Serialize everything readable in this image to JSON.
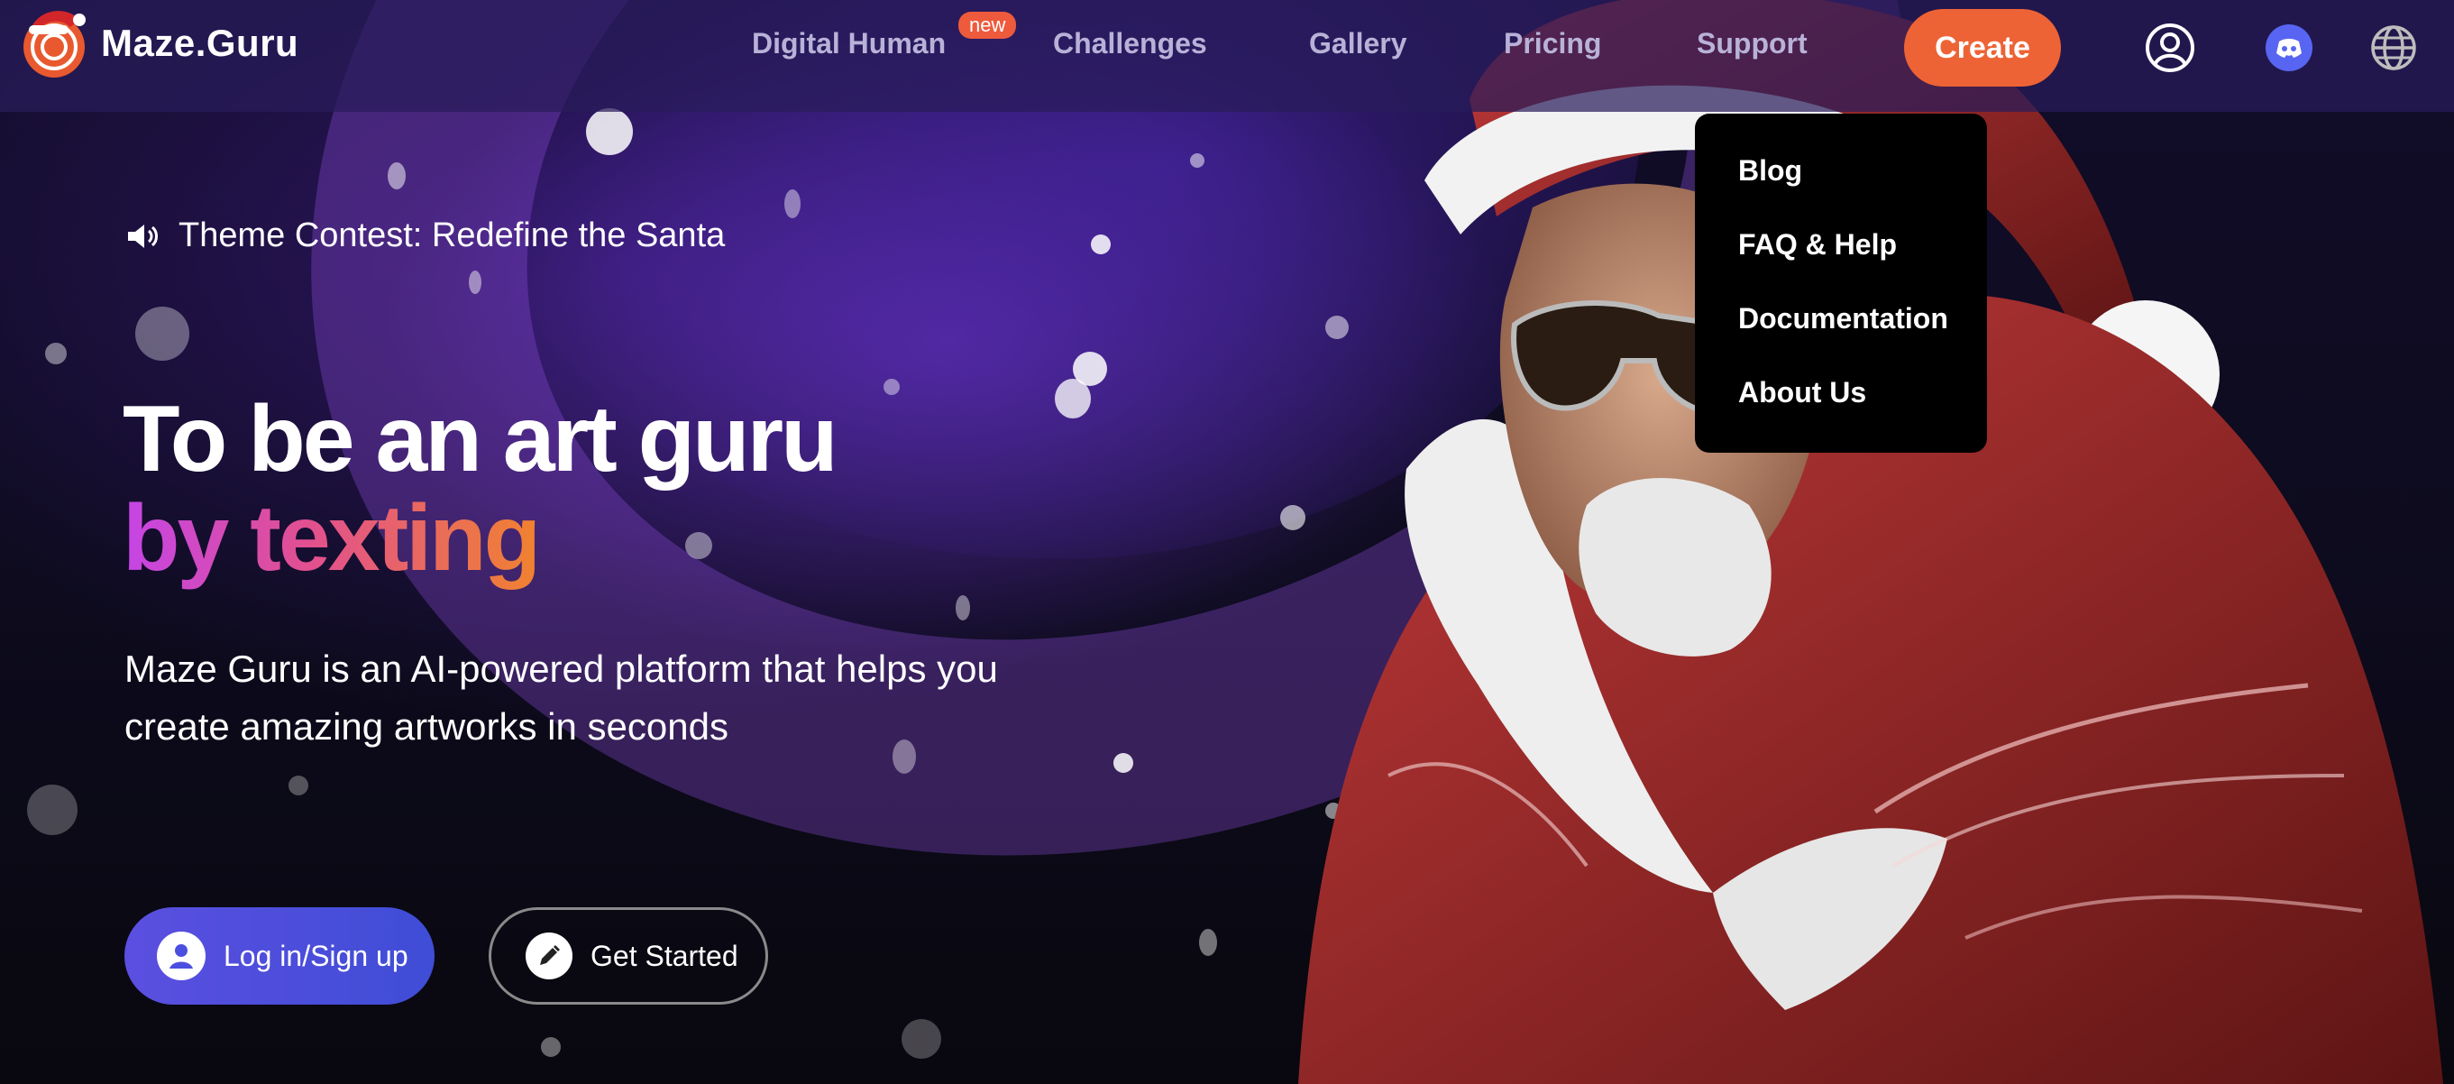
{
  "brand": {
    "name": "Maze.Guru",
    "accent": "#ee6335"
  },
  "nav": {
    "items": [
      {
        "label": "Digital Human",
        "badge": "new"
      },
      {
        "label": "Challenges"
      },
      {
        "label": "Gallery"
      },
      {
        "label": "Pricing"
      },
      {
        "label": "Support"
      }
    ],
    "create_label": "Create",
    "icons": [
      "user-icon",
      "discord-icon",
      "globe-icon"
    ]
  },
  "support_menu": {
    "items": [
      "Blog",
      "FAQ & Help",
      "Documentation",
      "About Us"
    ]
  },
  "hero": {
    "contest": "Theme Contest: Redefine the Santa",
    "headline_line1": "To be an art guru",
    "headline_line2": "by texting",
    "description_line1": "Maze Guru is an AI-powered platform that helps you",
    "description_line2": "create amazing artworks in seconds",
    "login_label": "Log in/Sign up",
    "start_label": "Get Started"
  }
}
